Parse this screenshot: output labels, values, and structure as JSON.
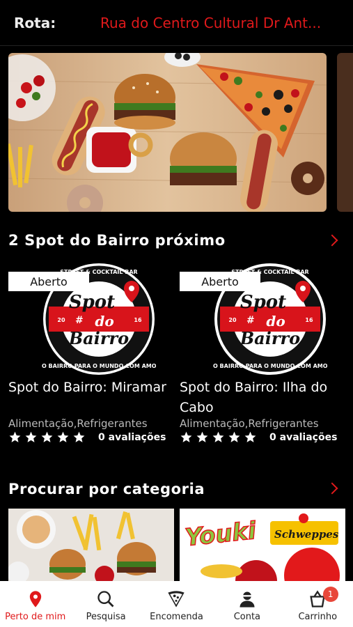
{
  "header": {
    "route_label": "Rota:",
    "route_value": "Rua do Centro Cultural Dr Ant..."
  },
  "nearby": {
    "title": "2 Spot do Bairro próximo",
    "cards": [
      {
        "status": "Aberto",
        "name": "Spot do Bairro: Miramar",
        "categories": "Alimentação,Refrigerantes",
        "rating_text": "0 avaliações",
        "stars": 0
      },
      {
        "status": "Aberto",
        "name": "Spot do Bairro: Ilha do Cabo",
        "categories": "Alimentação,Refrigerantes",
        "rating_text": "0 avaliações",
        "stars": 0
      }
    ],
    "logo": {
      "top_arc": "STREET & COCKTAIL BAR",
      "bottom_arc": "DO BAIRRO PARA O MUNDO COM AMOR",
      "line1": "Spot",
      "line2": "do",
      "line3": "Bairro",
      "year_left": "20",
      "year_right": "16",
      "hash": "#"
    }
  },
  "categories": {
    "title": "Procurar por categoria",
    "tiles": [
      {
        "name": "food-category"
      },
      {
        "name": "drinks-category",
        "brand1": "Youki",
        "brand2": "Schweppes"
      }
    ]
  },
  "tabbar": {
    "items": [
      {
        "label": "Perto de mim",
        "icon": "location-pin-icon",
        "active": true
      },
      {
        "label": "Pesquisa",
        "icon": "search-icon"
      },
      {
        "label": "Encomenda",
        "icon": "pizza-slice-icon"
      },
      {
        "label": "Conta",
        "icon": "user-icon"
      },
      {
        "label": "Carrinho",
        "icon": "basket-icon",
        "badge": "1"
      }
    ]
  },
  "colors": {
    "accent": "#e0191b",
    "background": "#000000",
    "tabbar": "#ffffff",
    "badge": "#e8473a"
  }
}
